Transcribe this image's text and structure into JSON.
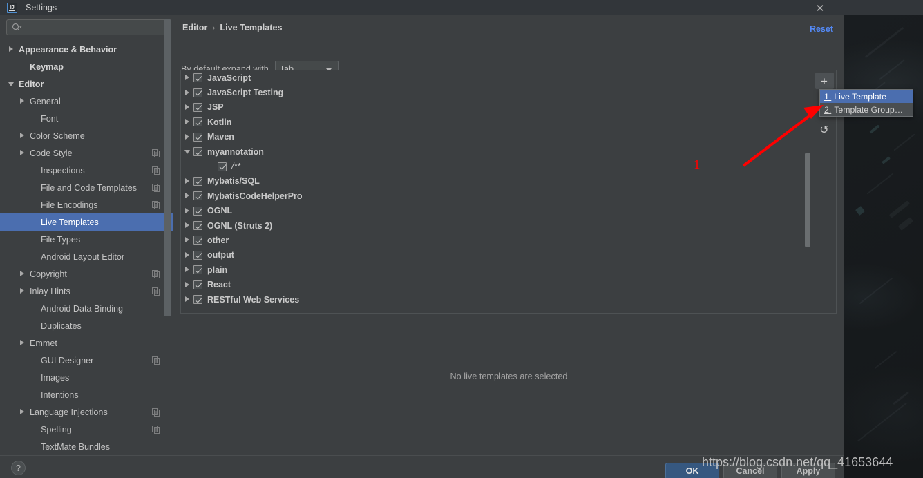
{
  "window": {
    "title": "Settings",
    "logo_text": "IJ",
    "close_icon": "close-icon"
  },
  "sidebar": {
    "search": {
      "placeholder": "",
      "value": "",
      "icon": "search-icon"
    },
    "items": [
      {
        "label": "Appearance & Behavior",
        "indent": 0,
        "arrow": "right",
        "bold": true,
        "copy": false,
        "selected": false
      },
      {
        "label": "Keymap",
        "indent": 1,
        "arrow": "none",
        "bold": true,
        "copy": false,
        "selected": false
      },
      {
        "label": "Editor",
        "indent": 0,
        "arrow": "down",
        "bold": true,
        "copy": false,
        "selected": false
      },
      {
        "label": "General",
        "indent": 1,
        "arrow": "right",
        "bold": false,
        "copy": false,
        "selected": false
      },
      {
        "label": "Font",
        "indent": 2,
        "arrow": "none",
        "bold": false,
        "copy": false,
        "selected": false
      },
      {
        "label": "Color Scheme",
        "indent": 1,
        "arrow": "right",
        "bold": false,
        "copy": false,
        "selected": false
      },
      {
        "label": "Code Style",
        "indent": 1,
        "arrow": "right",
        "bold": false,
        "copy": true,
        "selected": false
      },
      {
        "label": "Inspections",
        "indent": 2,
        "arrow": "none",
        "bold": false,
        "copy": true,
        "selected": false
      },
      {
        "label": "File and Code Templates",
        "indent": 2,
        "arrow": "none",
        "bold": false,
        "copy": true,
        "selected": false
      },
      {
        "label": "File Encodings",
        "indent": 2,
        "arrow": "none",
        "bold": false,
        "copy": true,
        "selected": false
      },
      {
        "label": "Live Templates",
        "indent": 2,
        "arrow": "none",
        "bold": false,
        "copy": false,
        "selected": true
      },
      {
        "label": "File Types",
        "indent": 2,
        "arrow": "none",
        "bold": false,
        "copy": false,
        "selected": false
      },
      {
        "label": "Android Layout Editor",
        "indent": 2,
        "arrow": "none",
        "bold": false,
        "copy": false,
        "selected": false
      },
      {
        "label": "Copyright",
        "indent": 1,
        "arrow": "right",
        "bold": false,
        "copy": true,
        "selected": false
      },
      {
        "label": "Inlay Hints",
        "indent": 1,
        "arrow": "right",
        "bold": false,
        "copy": true,
        "selected": false
      },
      {
        "label": "Android Data Binding",
        "indent": 2,
        "arrow": "none",
        "bold": false,
        "copy": false,
        "selected": false
      },
      {
        "label": "Duplicates",
        "indent": 2,
        "arrow": "none",
        "bold": false,
        "copy": false,
        "selected": false
      },
      {
        "label": "Emmet",
        "indent": 1,
        "arrow": "right",
        "bold": false,
        "copy": false,
        "selected": false
      },
      {
        "label": "GUI Designer",
        "indent": 2,
        "arrow": "none",
        "bold": false,
        "copy": true,
        "selected": false
      },
      {
        "label": "Images",
        "indent": 2,
        "arrow": "none",
        "bold": false,
        "copy": false,
        "selected": false
      },
      {
        "label": "Intentions",
        "indent": 2,
        "arrow": "none",
        "bold": false,
        "copy": false,
        "selected": false
      },
      {
        "label": "Language Injections",
        "indent": 1,
        "arrow": "right",
        "bold": false,
        "copy": true,
        "selected": false
      },
      {
        "label": "Spelling",
        "indent": 2,
        "arrow": "none",
        "bold": false,
        "copy": true,
        "selected": false
      },
      {
        "label": "TextMate Bundles",
        "indent": 2,
        "arrow": "none",
        "bold": false,
        "copy": false,
        "selected": false
      }
    ]
  },
  "main": {
    "breadcrumb": {
      "parent": "Editor",
      "separator": "›",
      "current": "Live Templates"
    },
    "reset_label": "Reset",
    "expand_label": "By default expand with",
    "expand_value": "Tab",
    "empty_message": "No live templates are selected",
    "toolbar": {
      "add_label": "+",
      "undo_label": "↺"
    },
    "templates": [
      {
        "label": "JavaScript",
        "arrow": "right",
        "checked": true,
        "child": false
      },
      {
        "label": "JavaScript Testing",
        "arrow": "right",
        "checked": true,
        "child": false
      },
      {
        "label": "JSP",
        "arrow": "right",
        "checked": true,
        "child": false
      },
      {
        "label": "Kotlin",
        "arrow": "right",
        "checked": true,
        "child": false
      },
      {
        "label": "Maven",
        "arrow": "right",
        "checked": true,
        "child": false
      },
      {
        "label": "myannotation",
        "arrow": "down",
        "checked": true,
        "child": false
      },
      {
        "label": "/**",
        "arrow": "none",
        "checked": true,
        "child": true
      },
      {
        "label": "Mybatis/SQL",
        "arrow": "right",
        "checked": true,
        "child": false
      },
      {
        "label": "MybatisCodeHelperPro",
        "arrow": "right",
        "checked": true,
        "child": false
      },
      {
        "label": "OGNL",
        "arrow": "right",
        "checked": true,
        "child": false
      },
      {
        "label": "OGNL (Struts 2)",
        "arrow": "right",
        "checked": true,
        "child": false
      },
      {
        "label": "other",
        "arrow": "right",
        "checked": true,
        "child": false
      },
      {
        "label": "output",
        "arrow": "right",
        "checked": true,
        "child": false
      },
      {
        "label": "plain",
        "arrow": "right",
        "checked": true,
        "child": false
      },
      {
        "label": "React",
        "arrow": "right",
        "checked": true,
        "child": false
      },
      {
        "label": "RESTful Web Services",
        "arrow": "right",
        "checked": true,
        "child": false
      }
    ]
  },
  "popup": {
    "items": [
      {
        "num": "1.",
        "label": "Live Template",
        "highlighted": true
      },
      {
        "num": "2.",
        "label": "Template Group…",
        "highlighted": false
      }
    ]
  },
  "footer": {
    "help_label": "?",
    "ok_label": "OK",
    "cancel_label": "Cancel",
    "apply_label": "Apply"
  },
  "annotations": {
    "step_number": "1",
    "watermark": "https://blog.csdn.net/qq_41653644",
    "arrow_color": "#ff0000"
  },
  "colors": {
    "dialog_bg": "#3c3f41",
    "titlebar_bg": "#32363a",
    "selection_blue": "#4b6eaf",
    "link_blue": "#548af7",
    "ok_button": "#365880",
    "text": "#bbbbbb"
  }
}
